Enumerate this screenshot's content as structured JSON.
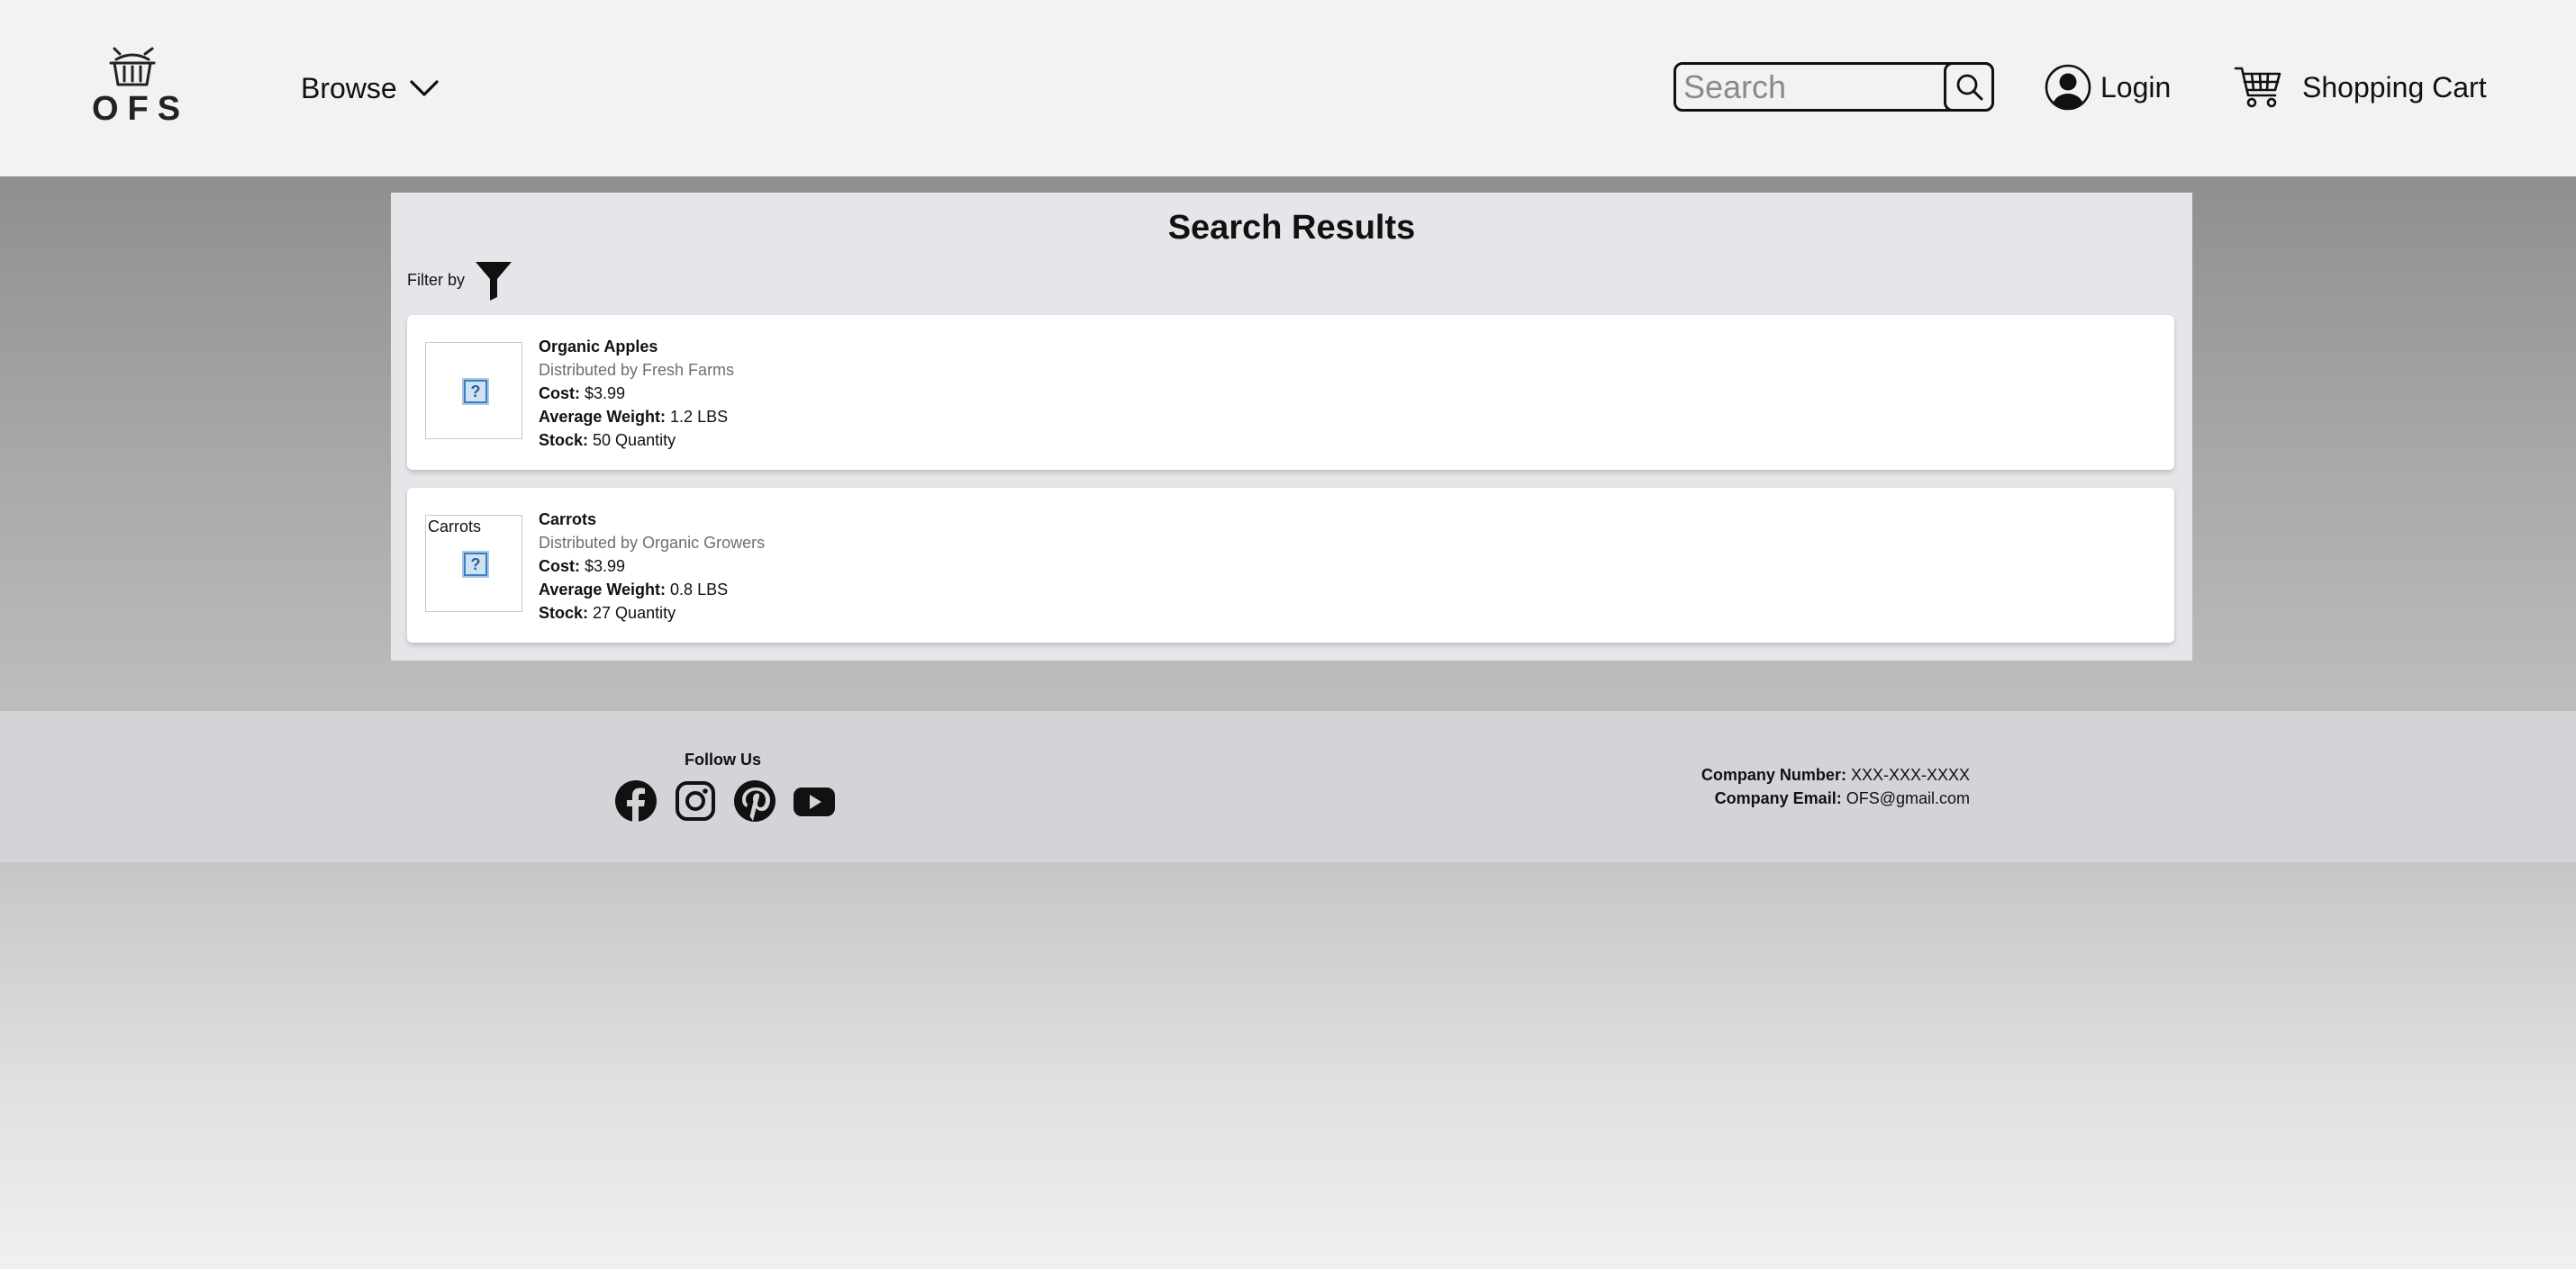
{
  "header": {
    "logo_text": "OFS",
    "browse_label": "Browse",
    "search_placeholder": "Search",
    "login_label": "Login",
    "cart_label": "Shopping Cart"
  },
  "results": {
    "title": "Search Results",
    "filter_label": "Filter by",
    "items": [
      {
        "name": "Organic Apples",
        "thumb_alt": "",
        "distributor": "Distributed by Fresh Farms",
        "cost_label": "Cost:",
        "cost": "$3.99",
        "weight_label": "Average Weight:",
        "weight": "1.2 LBS",
        "stock_label": "Stock:",
        "stock": "50 Quantity"
      },
      {
        "name": "Carrots",
        "thumb_alt": "Carrots",
        "distributor": "Distributed by Organic Growers",
        "cost_label": "Cost:",
        "cost": "$3.99",
        "weight_label": "Average Weight:",
        "weight": "0.8 LBS",
        "stock_label": "Stock:",
        "stock": "27 Quantity"
      }
    ]
  },
  "footer": {
    "follow_title": "Follow Us",
    "socials": [
      "facebook-icon",
      "instagram-icon",
      "pinterest-icon",
      "youtube-icon"
    ],
    "company_number_label": "Company Number:",
    "company_number": "XXX-XXX-XXXX",
    "company_email_label": "Company Email:",
    "company_email": "OFS@gmail.com"
  },
  "colors": {
    "header_bg": "#f2f2f2",
    "panel_bg": "#e5e6e9",
    "footer_bg": "#d2d4d8",
    "distributor_text": "#6b6e78"
  }
}
